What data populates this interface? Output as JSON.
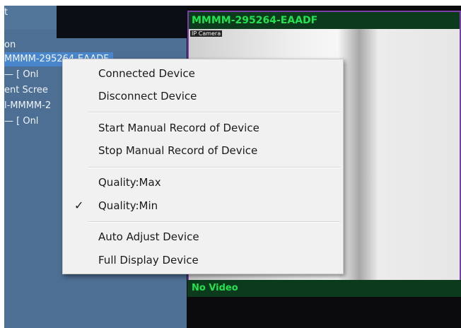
{
  "tree": {
    "rows": [
      {
        "text": "t"
      },
      {
        "text": "on"
      },
      {
        "text": "MMMM-295264-EAADF"
      },
      {
        "text": "— [  Onl"
      },
      {
        "text": "ent Scree"
      },
      {
        "text": "l-MMMM-2"
      },
      {
        "text": "— [  Onl"
      }
    ]
  },
  "video": {
    "panel1_title": "MMMM-295264-EAADF",
    "camera_label": "IP Camera",
    "panel2_title": "No Video"
  },
  "context_menu": {
    "items": [
      {
        "label": "Connected Device",
        "checked": false
      },
      {
        "label": "Disconnect Device",
        "checked": false
      },
      {
        "label": "Start Manual Record of Device",
        "checked": false
      },
      {
        "label": "Stop Manual Record of Device",
        "checked": false
      },
      {
        "label": "Quality:Max",
        "checked": false
      },
      {
        "label": "Quality:Min",
        "checked": true
      },
      {
        "label": "Auto Adjust Device",
        "checked": false
      },
      {
        "label": "Full Display Device",
        "checked": false
      }
    ],
    "check_glyph": "✓"
  }
}
